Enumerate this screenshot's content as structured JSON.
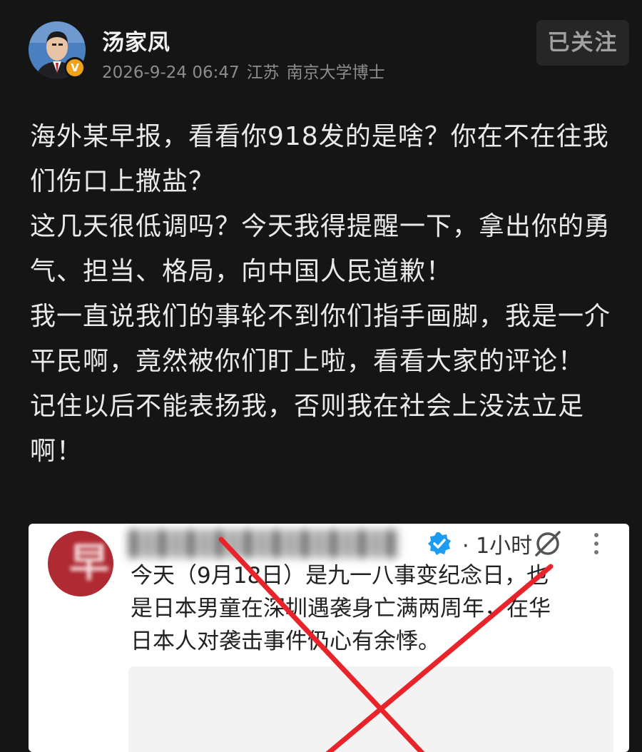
{
  "header": {
    "author_name": "汤家凤",
    "timestamp": "2026-9-24 06:47",
    "location": "江苏",
    "credential": "南京大学博士",
    "follow_label": "已关注",
    "verified_badge": "V"
  },
  "post": {
    "paragraphs": [
      "海外某早报，看看你918发的是啥？你在不在往我们伤口上撒盐？",
      "这几天很低调吗？今天我得提醒一下，拿出你的勇气、担当、格局，向中国人民道歉！",
      "我一直说我们的事轮不到你们指手画脚，我是一介平民啊，竟然被你们盯上啦，看看大家的评论！",
      "记住以后不能表扬我，否则我在社会上没法立足啊！"
    ]
  },
  "quoted": {
    "time": "· 1小时",
    "text_lines": [
      "今天（9月18日）是九一八事变纪念日，也",
      "是日本男童在深圳遇袭身亡满两周年，在华",
      "日本人对袭击事件仍心有余悸。"
    ],
    "avatar_glyph": "早",
    "icons": {
      "verified": "verified-check-icon",
      "grok": "grok-icon",
      "more": "more-vertical-icon"
    },
    "colors": {
      "avatar": "#b02a33",
      "verified": "#1d9bf0",
      "cross": "#e8232a"
    }
  },
  "theme": {
    "background": "#151515",
    "text": "#eaeaea",
    "meta": "#8c8c8c",
    "badge": "#f0a21b"
  }
}
